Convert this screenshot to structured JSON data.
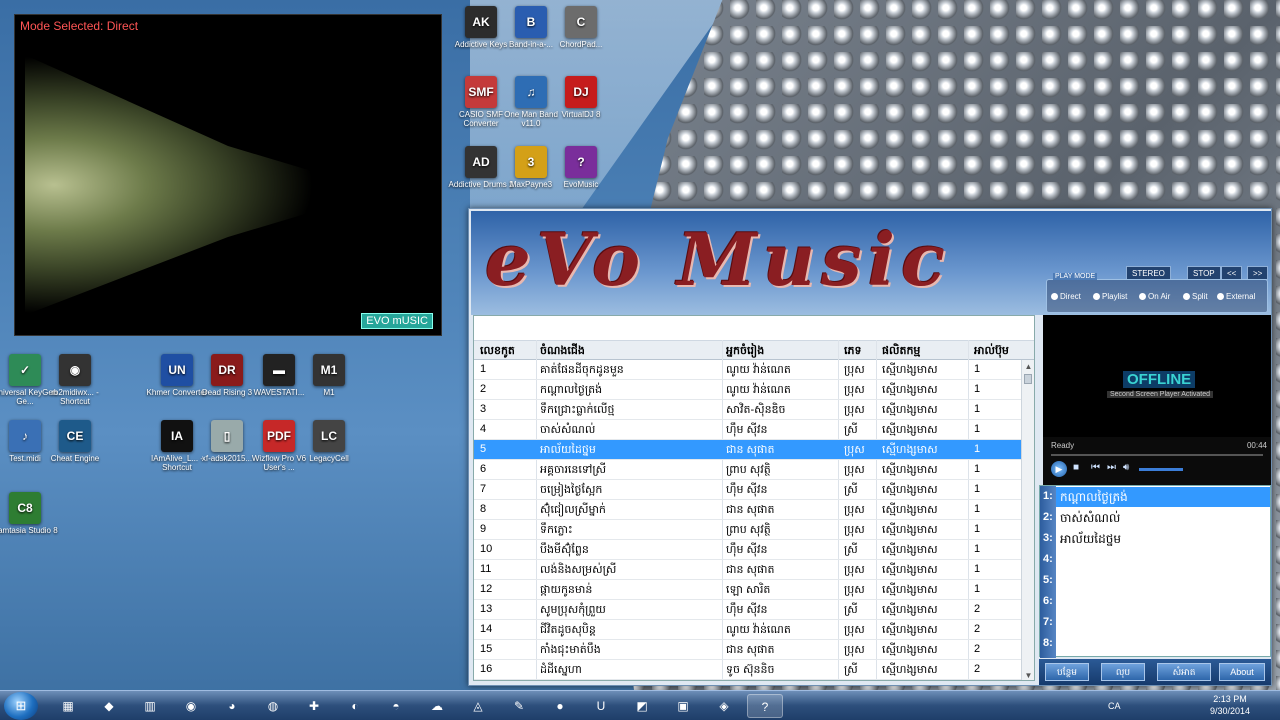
{
  "visualizer": {
    "mode_text": "Mode Selected: Direct",
    "tag": "EVO mUSIC"
  },
  "desktop_icons": [
    {
      "label": "Addictive Keys",
      "glyph": "AK",
      "color": "#2c2c2c"
    },
    {
      "label": "Band-in-a-...",
      "glyph": "B",
      "color": "#2a5db0"
    },
    {
      "label": "ChordPad...",
      "glyph": "C",
      "color": "#6c6c6c"
    },
    {
      "label": "CASIO SMF Converter",
      "glyph": "SMF",
      "color": "#c43a3a"
    },
    {
      "label": "One Man Band v11.0",
      "glyph": "♫",
      "color": "#2e6db4"
    },
    {
      "label": "VirtualDJ 8",
      "glyph": "DJ",
      "color": "#c61c1c"
    },
    {
      "label": "Addictive Drums 2",
      "glyph": "AD",
      "color": "#333"
    },
    {
      "label": "MaxPayne3",
      "glyph": "3",
      "color": "#d4a017"
    },
    {
      "label": "EvoMusic",
      "glyph": "?",
      "color": "#7a2e9b"
    },
    {
      "label": "Universal KeyGen Ge...",
      "glyph": "✓",
      "color": "#2e8b57"
    },
    {
      "label": "rb2midiwx... - Shortcut",
      "glyph": "◉",
      "color": "#333"
    },
    {
      "label": "Khmer Converter",
      "glyph": "UN",
      "color": "#1f4fa3"
    },
    {
      "label": "Dead Rising 3",
      "glyph": "DR",
      "color": "#8a1b1b"
    },
    {
      "label": "WAVESTATI...",
      "glyph": "▬",
      "color": "#222"
    },
    {
      "label": "M1",
      "glyph": "M1",
      "color": "#333"
    },
    {
      "label": "Test.midi",
      "glyph": "♪",
      "color": "#3a70b5"
    },
    {
      "label": "Cheat Engine",
      "glyph": "CE",
      "color": "#1e5a8a"
    },
    {
      "label": "IAmAlive_L... - Shortcut",
      "glyph": "IA",
      "color": "#111"
    },
    {
      "label": "xf-adsk2015...",
      "glyph": "▯",
      "color": "#9aa"
    },
    {
      "label": "Wizflow Pro V6 User's ...",
      "glyph": "PDF",
      "color": "#c62828"
    },
    {
      "label": "LegacyCell",
      "glyph": "LC",
      "color": "#444"
    },
    {
      "label": "Camtasia Studio 8",
      "glyph": "C8",
      "color": "#2e7d32"
    }
  ],
  "app": {
    "logo": "eVo Music",
    "buttons": {
      "stereo": "STEREO",
      "stop": "STOP",
      "prev": "<<",
      "next": ">>"
    },
    "play_mode": {
      "label": "PLAY MODE",
      "options": [
        "Direct",
        "Playlist",
        "On Air",
        "Split",
        "External"
      ]
    },
    "table": {
      "headers": [
        "លេខកូត",
        "ចំណងជើង",
        "អ្នកចំរៀង",
        "ភេទ",
        "ផលិតកម្ម",
        "អាល់ប៊ុម"
      ],
      "rows": [
        [
          "1",
          "គាត់ផែនដីចុកដូនមួន",
          "ណូយ វ៉ាន់ណេត",
          "ប្រុស",
          "ស្មើហង្សមាស",
          "1"
        ],
        [
          "2",
          "កណ្ដាលថ្ងៃត្រង់",
          "ណូយ វ៉ាន់ណេត",
          "ប្រុស",
          "ស្មើហង្សមាស",
          "1"
        ],
        [
          "3",
          "ទឹកជ្រោះធ្លាក់លើថ្ម",
          "សាវិត-ស៊ិនឌិច",
          "ប្រុស",
          "ស្មើហង្សមាស",
          "1"
        ],
        [
          "4",
          "ចាស់សំណល់",
          "ហ៊ឹម ស៊ីវន",
          "ស្រី",
          "ស្មើហង្សមាស",
          "1"
        ],
        [
          "5",
          "អាល័យដៃថ្នម",
          "ជាន សុផាត",
          "ប្រុស",
          "ស្មើហង្សមាស",
          "1"
        ],
        [
          "6",
          "អគ្គចារនេទៅស្រី",
          "ព្រាប សុវត្ថិ",
          "ប្រុស",
          "ស្មើហង្សមាស",
          "1"
        ],
        [
          "7",
          "ចម្រៀងថ្ងៃស្អែក",
          "ហ៊ឹម ស៊ីវន",
          "ស្រី",
          "ស្មើហង្សមាស",
          "1"
        ],
        [
          "8",
          "ស៊ុំជៀលស្រីម្នាក់",
          "ជាន សុផាត",
          "ប្រុស",
          "ស្មើហង្សមាស",
          "1"
        ],
        [
          "9",
          "ទឹកភ្លោះ",
          "ព្រាប សុវត្ថិ",
          "ប្រុស",
          "ស្មើហង្សមាស",
          "1"
        ],
        [
          "10",
          "បឹងមីស៊ុំព្លែន",
          "ហ៊ឹម ស៊ីវន",
          "ស្រី",
          "ស្មើហង្សមាស",
          "1"
        ],
        [
          "11",
          "លង់និងសម្រស់ស្រី",
          "ជាន សុផាត",
          "ប្រុស",
          "ស្មើហង្សមាស",
          "1"
        ],
        [
          "12",
          "ផ្កាយកូនមាន់",
          "ឡោ សារិត",
          "ប្រុស",
          "ស្មើហង្សមាស",
          "1"
        ],
        [
          "13",
          "សូមប្រុសកុំព្រួយ",
          "ហ៊ឹម ស៊ីវន",
          "ស្រី",
          "ស្មើហង្សមាស",
          "2"
        ],
        [
          "14",
          "ជីវិតដូចសុបិន្ត",
          "ណូយ វ៉ាន់ណេត",
          "ប្រុស",
          "ស្មើហង្សមាស",
          "2"
        ],
        [
          "15",
          "កាំងជុះមាត់បឹង",
          "ជាន សុផាត",
          "ប្រុស",
          "ស្មើហង្សមាស",
          "2"
        ],
        [
          "16",
          "ដំដីស្នេហា",
          "ទូច ស៊ុននិច",
          "ស្រី",
          "ស្មើហង្សមាស",
          "2"
        ]
      ],
      "selected_row": 4
    },
    "second_screen": {
      "status": "OFFLINE",
      "note": "Second Screen Player Activated"
    },
    "player": {
      "state": "Ready",
      "time": "00:44"
    },
    "playlist": {
      "numbers": [
        "1:",
        "2:",
        "3:",
        "4:",
        "5:",
        "6:",
        "7:",
        "8:"
      ],
      "items": [
        "កណ្ដាលថ្ងៃត្រង់",
        "ចាស់សំណល់",
        "អាល័យដៃថ្នម"
      ]
    },
    "bottom_buttons": [
      "បន្ថែម",
      "លុប",
      "សំអាត",
      "About"
    ]
  },
  "taskbar": {
    "start": "⊞",
    "items": [
      "▦",
      "◆",
      "▥",
      "◉",
      "◕",
      "◍",
      "✚",
      "◐",
      "◓",
      "☁",
      "◬",
      "✎",
      "●",
      "U",
      "◩",
      "▣",
      "◈",
      "?"
    ],
    "lang": "CA",
    "time": "2:13 PM",
    "date": "9/30/2014"
  }
}
